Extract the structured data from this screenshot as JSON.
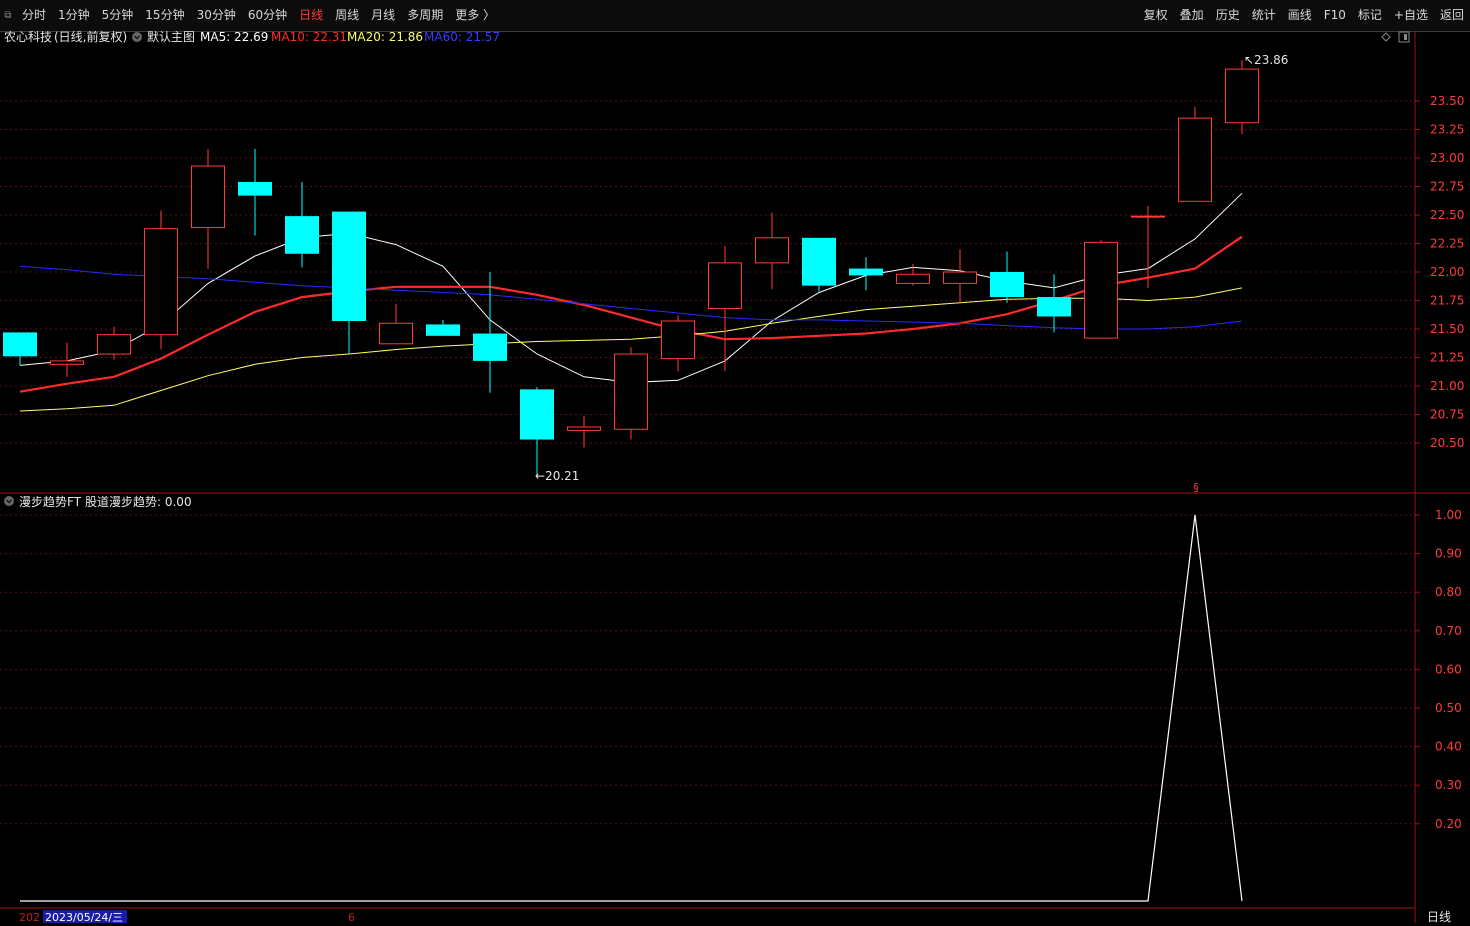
{
  "toolbar": {
    "left_items": [
      {
        "label": "分时",
        "active": false
      },
      {
        "label": "1分钟",
        "active": false
      },
      {
        "label": "5分钟",
        "active": false
      },
      {
        "label": "15分钟",
        "active": false
      },
      {
        "label": "30分钟",
        "active": false
      },
      {
        "label": "60分钟",
        "active": false
      },
      {
        "label": "日线",
        "active": true
      },
      {
        "label": "周线",
        "active": false
      },
      {
        "label": "月线",
        "active": false
      },
      {
        "label": "多周期",
        "active": false
      },
      {
        "label": "更多 〉",
        "active": false
      }
    ],
    "right_items": [
      "复权",
      "叠加",
      "历史",
      "统计",
      "画线",
      "F10",
      "标记",
      "+自选",
      "返回"
    ]
  },
  "main_panel": {
    "stock_name": "农心科技",
    "period_label": "(日线,前复权)",
    "template_label": "默认主图",
    "ma5_label": "MA5: 22.69",
    "ma10_label": "MA10: 22.31",
    "ma20_label": "MA20: 21.86",
    "ma60_label": "MA60: 21.57",
    "high_label": "23.86",
    "low_label": "20.21",
    "colors": {
      "up": "#ff3b3b",
      "down": "#00ffff",
      "ma5": "#ffffff",
      "ma10": "#ff2a2a",
      "ma20": "#ffff66",
      "ma60": "#2a2aff"
    }
  },
  "indicator_panel": {
    "name": "漫步趋势FT",
    "value_label": "股道漫步趋势: 0.00"
  },
  "bottom_axis": {
    "left_year": "202",
    "selected_date": "2023/05/24/三",
    "month_marker": "6",
    "period_button": "日线"
  },
  "chart_data": [
    {
      "type": "candlestick",
      "title": "农心科技 (日线,前复权)",
      "ylim": [
        20.2,
        23.9
      ],
      "y_ticks": [
        20.5,
        20.75,
        21.0,
        21.25,
        21.5,
        21.75,
        22.0,
        22.25,
        22.5,
        22.75,
        23.0,
        23.25,
        23.5
      ],
      "candles": [
        {
          "o": 21.47,
          "c": 21.26,
          "h": 21.47,
          "l": 21.18
        },
        {
          "o": 21.19,
          "c": 21.22,
          "h": 21.38,
          "l": 21.08
        },
        {
          "o": 21.28,
          "c": 21.45,
          "h": 21.52,
          "l": 21.23
        },
        {
          "o": 21.45,
          "c": 22.38,
          "h": 22.54,
          "l": 21.32
        },
        {
          "o": 22.39,
          "c": 22.93,
          "h": 23.08,
          "l": 22.03
        },
        {
          "o": 22.79,
          "c": 22.67,
          "h": 23.08,
          "l": 22.32
        },
        {
          "o": 22.49,
          "c": 22.16,
          "h": 22.79,
          "l": 22.04
        },
        {
          "o": 22.53,
          "c": 21.57,
          "h": 22.53,
          "l": 21.28
        },
        {
          "o": 21.37,
          "c": 21.55,
          "h": 21.72,
          "l": 21.37
        },
        {
          "o": 21.54,
          "c": 21.44,
          "h": 21.58,
          "l": 21.44
        },
        {
          "o": 21.46,
          "c": 21.22,
          "h": 22.0,
          "l": 20.94
        },
        {
          "o": 20.97,
          "c": 20.53,
          "h": 20.99,
          "l": 20.21
        },
        {
          "o": 20.61,
          "c": 20.64,
          "h": 20.74,
          "l": 20.46
        },
        {
          "o": 20.62,
          "c": 21.28,
          "h": 21.34,
          "l": 20.53
        },
        {
          "o": 21.24,
          "c": 21.57,
          "h": 21.62,
          "l": 21.13
        },
        {
          "o": 21.68,
          "c": 22.08,
          "h": 22.23,
          "l": 21.13
        },
        {
          "o": 22.08,
          "c": 22.3,
          "h": 22.52,
          "l": 21.85
        },
        {
          "o": 22.3,
          "c": 21.88,
          "h": 22.3,
          "l": 21.83
        },
        {
          "o": 22.03,
          "c": 21.97,
          "h": 22.13,
          "l": 21.84
        },
        {
          "o": 21.9,
          "c": 21.98,
          "h": 22.07,
          "l": 21.88
        },
        {
          "o": 21.9,
          "c": 22.0,
          "h": 22.2,
          "l": 21.73
        },
        {
          "o": 22.0,
          "c": 21.78,
          "h": 22.18,
          "l": 21.73
        },
        {
          "o": 21.78,
          "c": 21.61,
          "h": 21.98,
          "l": 21.47
        },
        {
          "o": 21.42,
          "c": 22.26,
          "h": 22.28,
          "l": 21.42
        },
        {
          "o": 22.49,
          "c": 22.49,
          "h": 22.58,
          "l": 21.86
        },
        {
          "o": 22.62,
          "c": 23.35,
          "h": 23.45,
          "l": 22.62
        },
        {
          "o": 23.31,
          "c": 23.78,
          "h": 23.86,
          "l": 23.21
        }
      ],
      "series": [
        {
          "name": "MA5",
          "values": [
            21.18,
            21.22,
            21.31,
            21.54,
            21.9,
            22.14,
            22.3,
            22.34,
            22.24,
            22.05,
            21.58,
            21.28,
            21.08,
            21.03,
            21.05,
            21.22,
            21.57,
            21.82,
            21.97,
            22.04,
            22.01,
            21.92,
            21.86,
            21.97,
            22.03,
            22.29,
            22.69
          ]
        },
        {
          "name": "MA10",
          "values": [
            20.95,
            21.02,
            21.08,
            21.24,
            21.45,
            21.65,
            21.78,
            21.83,
            21.87,
            21.87,
            21.87,
            21.8,
            21.71,
            21.6,
            21.49,
            21.41,
            21.42,
            21.44,
            21.46,
            21.5,
            21.55,
            21.63,
            21.75,
            21.88,
            21.95,
            22.03,
            22.31
          ]
        },
        {
          "name": "MA20",
          "values": [
            20.78,
            20.8,
            20.83,
            20.96,
            21.09,
            21.19,
            21.25,
            21.28,
            21.32,
            21.35,
            21.37,
            21.39,
            21.4,
            21.41,
            21.44,
            21.48,
            21.55,
            21.61,
            21.67,
            21.7,
            21.73,
            21.76,
            21.77,
            21.77,
            21.75,
            21.78,
            21.86
          ]
        },
        {
          "name": "MA60",
          "values": [
            22.05,
            22.02,
            21.98,
            21.96,
            21.94,
            21.91,
            21.88,
            21.86,
            21.84,
            21.82,
            21.8,
            21.76,
            21.72,
            21.68,
            21.64,
            21.6,
            21.58,
            21.58,
            21.57,
            21.56,
            21.55,
            21.53,
            21.51,
            21.5,
            21.5,
            21.52,
            21.57
          ]
        }
      ]
    },
    {
      "type": "line",
      "title": "漫步趋势FT",
      "ylim": [
        0,
        1.0
      ],
      "y_ticks": [
        0.2,
        0.3,
        0.4,
        0.5,
        0.6,
        0.7,
        0.8,
        0.9,
        1.0
      ],
      "series": [
        {
          "name": "股道漫步趋势",
          "values": [
            0,
            0,
            0,
            0,
            0,
            0,
            0,
            0,
            0,
            0,
            0,
            0,
            0,
            0,
            0,
            0,
            0,
            0,
            0,
            0,
            0,
            0,
            0,
            0,
            0,
            1.0,
            0
          ]
        }
      ]
    }
  ]
}
